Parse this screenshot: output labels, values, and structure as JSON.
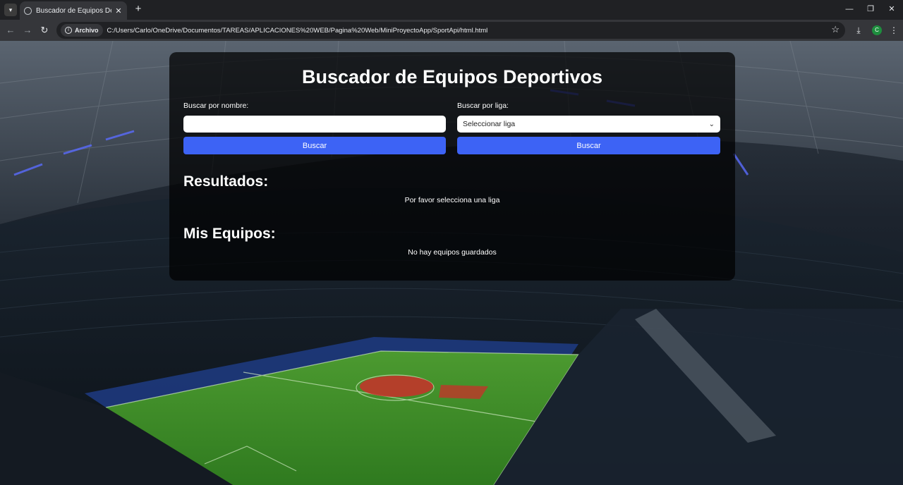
{
  "browser": {
    "tab_title": "Buscador de Equipos Deportivos",
    "tab_close": "✕",
    "new_tab": "+",
    "chip_label": "Archivo",
    "url": "C:/Users/Carlo/OneDrive/Documentos/TAREAS/APLICACIONES%20WEB/Pagina%20Web/MiniProyectoApp/SportApi/html.html",
    "profile_initial": "C",
    "icons": [
      "tab-list-icon",
      "globe-icon",
      "back-icon",
      "forward-icon",
      "reload-icon",
      "info-icon",
      "star-icon",
      "download-icon",
      "profile-icon",
      "menu-icon",
      "minimize-icon",
      "restore-icon",
      "close-icon"
    ]
  },
  "app": {
    "title": "Buscador de Equipos Deportivos",
    "search_name_label": "Buscar por nombre:",
    "search_name_value": "",
    "search_league_label": "Buscar por liga:",
    "league_select_value": "Seleccionar liga",
    "search_name_button": "Buscar",
    "search_league_button": "Buscar",
    "results_title": "Resultados:",
    "results_message": "Por favor selecciona una liga",
    "my_teams_title": "Mis Equipos:",
    "my_teams_message": "No hay equipos guardados"
  },
  "colors": {
    "button": "#3d63f5",
    "card": "rgba(0,0,0,0.72)",
    "pitch": "#3f8f2a"
  }
}
